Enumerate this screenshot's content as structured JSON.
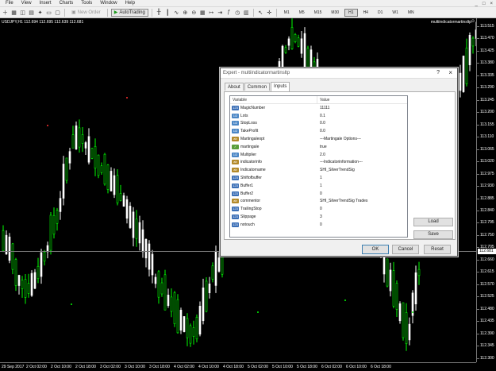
{
  "menu": [
    "File",
    "View",
    "Insert",
    "Charts",
    "Tools",
    "Window",
    "Help"
  ],
  "window_controls": [
    "_",
    "□",
    "×"
  ],
  "toolbar": {
    "new_order_label": "New Order",
    "autotrading_label": "AutoTrading",
    "timeframes": [
      "M1",
      "M5",
      "M15",
      "M30",
      "H1",
      "H4",
      "D1",
      "W1",
      "MN"
    ],
    "active_timeframe": "H1"
  },
  "chart": {
    "symbol_info": "USDJPY,H1  112.694 112.695 112.639 112.681",
    "ea_name": "multiindicatormartinsltp",
    "ea_face": "☺",
    "current_price": "112.681",
    "colors": {
      "background": "#000000",
      "bull": "#ffffff",
      "candle_green": "#00ff00",
      "axis": "#777777"
    },
    "price_ticks": [
      "113.515",
      "113.470",
      "113.425",
      "113.380",
      "113.335",
      "113.290",
      "113.245",
      "113.200",
      "113.155",
      "113.110",
      "113.065",
      "113.020",
      "112.975",
      "112.930",
      "112.885",
      "112.840",
      "112.795",
      "112.750",
      "112.705",
      "112.660",
      "112.615",
      "112.570",
      "112.525",
      "112.480",
      "112.435",
      "112.390",
      "112.345",
      "112.300"
    ],
    "time_ticks": [
      "29 Sep 2017",
      "2 Oct 02:00",
      "2 Oct 10:00",
      "2 Oct 18:00",
      "3 Oct 02:00",
      "3 Oct 10:00",
      "3 Oct 18:00",
      "4 Oct 02:00",
      "4 Oct 10:00",
      "4 Oct 18:00",
      "5 Oct 02:00",
      "5 Oct 10:00",
      "5 Oct 18:00",
      "6 Oct 02:00",
      "6 Oct 10:00",
      "6 Oct 18:00"
    ]
  },
  "dialog": {
    "title": "Expert - multiindicatormartinsltp",
    "help": "?",
    "close": "×",
    "tabs": [
      "About",
      "Common",
      "Inputs"
    ],
    "active_tab": "Inputs",
    "grid_headers": {
      "variable": "Variable",
      "value": "Value"
    },
    "params": [
      {
        "icon": "123",
        "type": "num",
        "name": "MagicNumber",
        "value": "11111"
      },
      {
        "icon": "1/2",
        "type": "dbl",
        "name": "Lots",
        "value": "0.1"
      },
      {
        "icon": "1/2",
        "type": "dbl",
        "name": "StopLoss",
        "value": "0.0"
      },
      {
        "icon": "1/2",
        "type": "dbl",
        "name": "TakeProfit",
        "value": "0.0"
      },
      {
        "icon": "ab",
        "type": "str",
        "name": "Martingaleopt",
        "value": "---Martingale Options---"
      },
      {
        "icon": "✓",
        "type": "bool",
        "name": "martingale",
        "value": "true"
      },
      {
        "icon": "1/2",
        "type": "dbl",
        "name": "Multiplier",
        "value": "2.0"
      },
      {
        "icon": "ab",
        "type": "str",
        "name": "indicatorinfo",
        "value": "---Indicatorinformation---"
      },
      {
        "icon": "ab",
        "type": "str",
        "name": "Indicatorname",
        "value": "SHI_SilverTrendSig"
      },
      {
        "icon": "123",
        "type": "num",
        "name": "Shiftofbuffer",
        "value": "1"
      },
      {
        "icon": "123",
        "type": "num",
        "name": "Buffer1",
        "value": "1"
      },
      {
        "icon": "123",
        "type": "num",
        "name": "Buffer2",
        "value": "0"
      },
      {
        "icon": "ab",
        "type": "str",
        "name": "commentor",
        "value": "SHI_SilverTrendSig Trades"
      },
      {
        "icon": "123",
        "type": "num",
        "name": "TrailingStop",
        "value": "0"
      },
      {
        "icon": "123",
        "type": "num",
        "name": "Slippage",
        "value": "3"
      },
      {
        "icon": "123",
        "type": "num",
        "name": "notouch",
        "value": "0"
      }
    ],
    "load_label": "Load",
    "save_label": "Save",
    "ok_label": "OK",
    "cancel_label": "Cancel",
    "reset_label": "Reset"
  }
}
